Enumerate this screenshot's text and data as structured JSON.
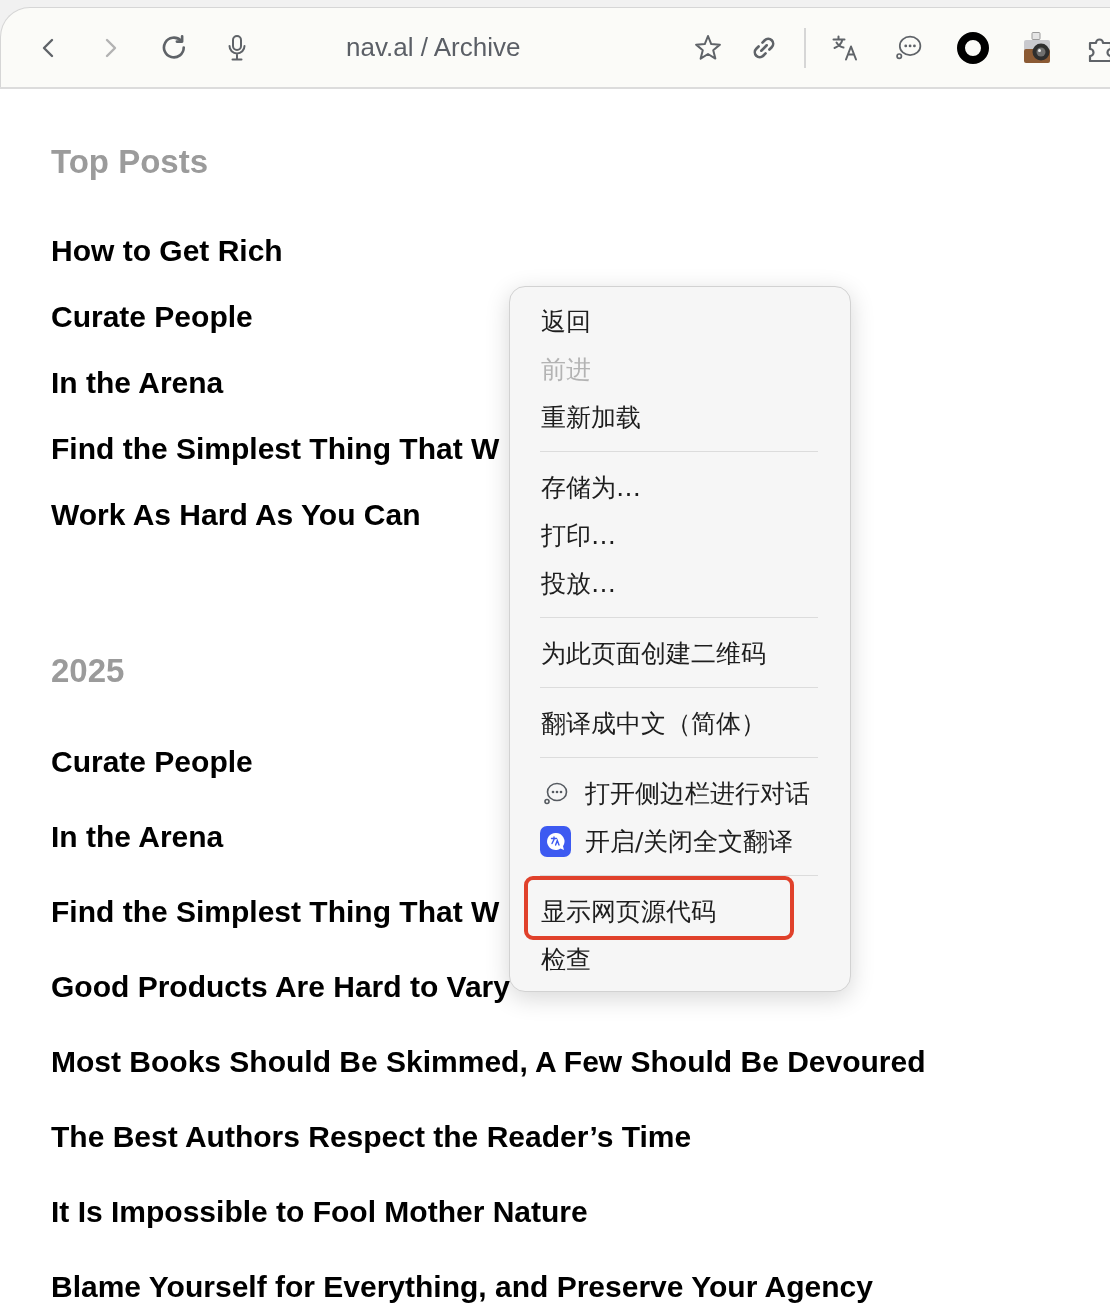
{
  "browser": {
    "nav_buttons": [
      {
        "kind": "back",
        "disabled": false
      },
      {
        "kind": "forward",
        "disabled": true
      },
      {
        "kind": "reload",
        "disabled": false
      },
      {
        "kind": "voice",
        "disabled": false
      }
    ],
    "address": "nav.al / Archive",
    "actions": [
      {
        "kind": "bookmark"
      },
      {
        "kind": "link"
      }
    ],
    "extensions": [
      {
        "kind": "translate"
      },
      {
        "kind": "chat"
      },
      {
        "kind": "ring"
      },
      {
        "kind": "camera"
      },
      {
        "kind": "puzzle"
      }
    ]
  },
  "sections": [
    {
      "heading": "Top Posts",
      "posts": [
        "How to Get Rich",
        "Curate People",
        "In the Arena",
        "Find the Simplest Thing That W",
        "Work As Hard As You Can"
      ]
    },
    {
      "heading": "2025",
      "posts": [
        "Curate People",
        "In the Arena",
        "Find the Simplest Thing That W",
        "Good Products Are Hard to Vary",
        "Most Books Should Be Skimmed, A Few Should Be Devoured",
        "The Best Authors Respect the Reader’s Time",
        "It Is Impossible to Fool Mother Nature",
        "Blame Yourself for Everything, and Preserve Your Agency"
      ]
    }
  ],
  "context_menu": {
    "groups": [
      [
        {
          "label": "返回",
          "kind": "text",
          "disabled": false,
          "highlighted": false
        },
        {
          "label": "前进",
          "kind": "text",
          "disabled": true,
          "highlighted": false
        },
        {
          "label": "重新加载",
          "kind": "text",
          "disabled": false,
          "highlighted": false
        }
      ],
      [
        {
          "label": "存储为…",
          "kind": "text",
          "disabled": false,
          "highlighted": false
        },
        {
          "label": "打印…",
          "kind": "text",
          "disabled": false,
          "highlighted": false
        },
        {
          "label": "投放…",
          "kind": "text",
          "disabled": false,
          "highlighted": false
        }
      ],
      [
        {
          "label": "为此页面创建二维码",
          "kind": "text",
          "disabled": false,
          "highlighted": false
        }
      ],
      [
        {
          "label": "翻译成中文（简体）",
          "kind": "text",
          "disabled": false,
          "highlighted": false
        }
      ],
      [
        {
          "label": "打开侧边栏进行对话",
          "kind": "chat",
          "disabled": false,
          "highlighted": false
        },
        {
          "label": "开启/关闭全文翻译",
          "kind": "translator",
          "disabled": false,
          "highlighted": false
        }
      ],
      [
        {
          "label": "显示网页源代码",
          "kind": "text",
          "disabled": false,
          "highlighted": true
        },
        {
          "label": "检查",
          "kind": "text",
          "disabled": false,
          "highlighted": false
        }
      ]
    ]
  }
}
